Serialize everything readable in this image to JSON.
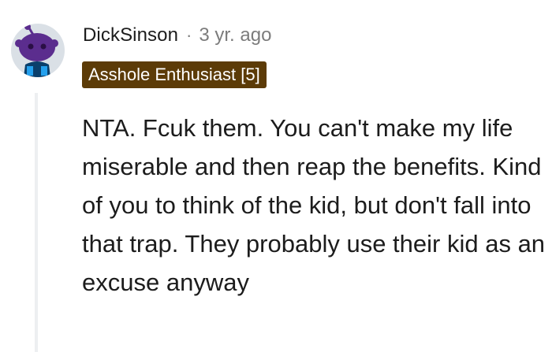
{
  "comment": {
    "author": "DickSinson",
    "separator": "·",
    "timestamp": "3 yr. ago",
    "flair": "Asshole Enthusiast [5]",
    "body": "NTA. Fcuk them. You can't make my life miserable and then reap the benefits. Kind of you to think of the kid, but don't fall into that trap. They probably use their kid as an excuse anyway"
  },
  "avatar": {
    "icon": "reddit-snoo-avatar-icon",
    "colors": {
      "background": "#dae0e6",
      "head": "#5b2d8e",
      "body": "#0a3f6b",
      "shirt_accent": "#24a0ed"
    }
  },
  "colors": {
    "text": "#1c1c1c",
    "muted": "#7c7c7c",
    "flair_background": "#5c3b07",
    "flair_text": "#ffffff",
    "thread_line": "#edeff1"
  }
}
